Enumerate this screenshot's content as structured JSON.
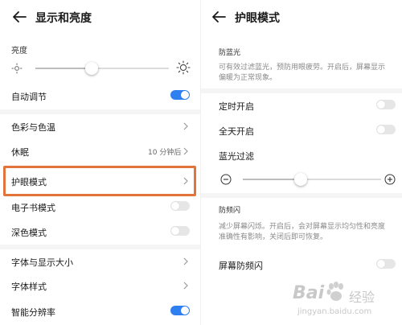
{
  "left": {
    "title": "显示和亮度",
    "brightness_label": "亮度",
    "brightness_level": 0.42,
    "auto_adjust": {
      "label": "自动调节",
      "on": true
    },
    "color_temp": {
      "label": "色彩与色温"
    },
    "sleep": {
      "label": "休眠",
      "value": "10 分钟后"
    },
    "eye_comfort": {
      "label": "护眼模式"
    },
    "ebook_mode": {
      "label": "电子书模式",
      "on": false
    },
    "dark_mode": {
      "label": "深色模式",
      "on": false
    },
    "font_size": {
      "label": "字体与显示大小"
    },
    "font_style": {
      "label": "字体样式"
    },
    "smart_resolution": {
      "label": "智能分辨率",
      "on": true
    }
  },
  "right": {
    "title": "护眼模式",
    "blue_light": {
      "section": "防蓝光",
      "desc_line1": "可有效过滤蓝光，预防用眼疲劳。开启后，屏幕显示",
      "desc_line2": "偏暖为正常现象。"
    },
    "scheduled": {
      "label": "定时开启",
      "on": false
    },
    "all_day": {
      "label": "全天开启",
      "on": false
    },
    "filter": {
      "label": "蓝光过滤",
      "level": 0.42
    },
    "flicker": {
      "section": "防频闪",
      "desc_line1": "减少屏幕闪烁。开启后，会对屏幕显示均匀性和亮度",
      "desc_line2": "准确性有影响，关闭后即可恢复。"
    },
    "anti_flicker": {
      "label": "屏幕防频闪",
      "on": false
    }
  },
  "watermark": {
    "brand": "Bai",
    "brand2": "经验",
    "sub": "jingyan.baidu.com"
  },
  "colors": {
    "accent": "#2f7ff0",
    "highlight": "#e0743b",
    "toggle_off": "#e6e6e6"
  }
}
